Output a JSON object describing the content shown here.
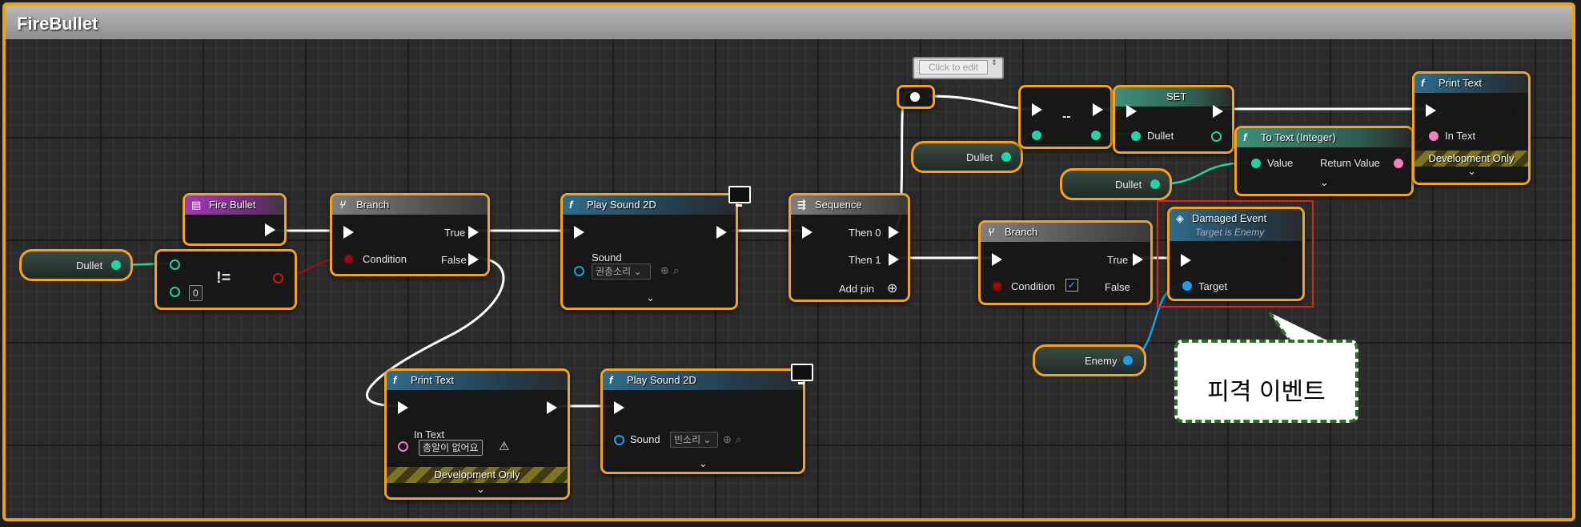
{
  "window": {
    "title": "FireBullet"
  },
  "variables": {
    "dullet_1": "Dullet",
    "dullet_2": "Dullet",
    "dullet_3": "Dullet",
    "enemy": "Enemy"
  },
  "nodes": {
    "fire_bullet": {
      "title": "Fire Bullet"
    },
    "not_equal": {
      "operator": "!=",
      "input_value": "0"
    },
    "branch_1": {
      "title": "Branch",
      "condition": "Condition",
      "true": "True",
      "false": "False"
    },
    "play_sound_1": {
      "title": "Play Sound 2D",
      "sound_label": "Sound",
      "sound_value": "권총소리"
    },
    "sequence": {
      "title": "Sequence",
      "then0": "Then 0",
      "then1": "Then 1",
      "add_pin": "Add pin"
    },
    "print_text_1": {
      "title": "Print Text",
      "in_text": "In Text",
      "in_text_value": "총알이 없어요",
      "dev_only": "Development Only"
    },
    "play_sound_2": {
      "title": "Play Sound 2D",
      "sound_label": "Sound",
      "sound_value": "빈소리"
    },
    "reroute": {
      "tooltip": "Click to edit"
    },
    "decrement": {
      "operator": "--"
    },
    "set": {
      "title": "SET",
      "var": "Dullet"
    },
    "print_text_2": {
      "title": "Print Text",
      "in_text": "In Text",
      "dev_only": "Development Only"
    },
    "to_text": {
      "title": "To Text (Integer)",
      "value": "Value",
      "return_value": "Return Value"
    },
    "branch_2": {
      "title": "Branch",
      "condition": "Condition",
      "true": "True",
      "false": "False"
    },
    "damaged_event": {
      "title": "Damaged Event",
      "subtitle": "Target is Enemy",
      "target": "Target"
    }
  },
  "annotation": {
    "text": "피격 이벤트"
  },
  "colors": {
    "node_border": "#f2a324",
    "exec": "#ffffff",
    "int_pin": "#1fd5a5",
    "bool_pin": "#9b0d0d",
    "text_pin": "#f07fbf",
    "object_pin": "#1aa0e8",
    "highlight_box": "#e51e1e"
  }
}
